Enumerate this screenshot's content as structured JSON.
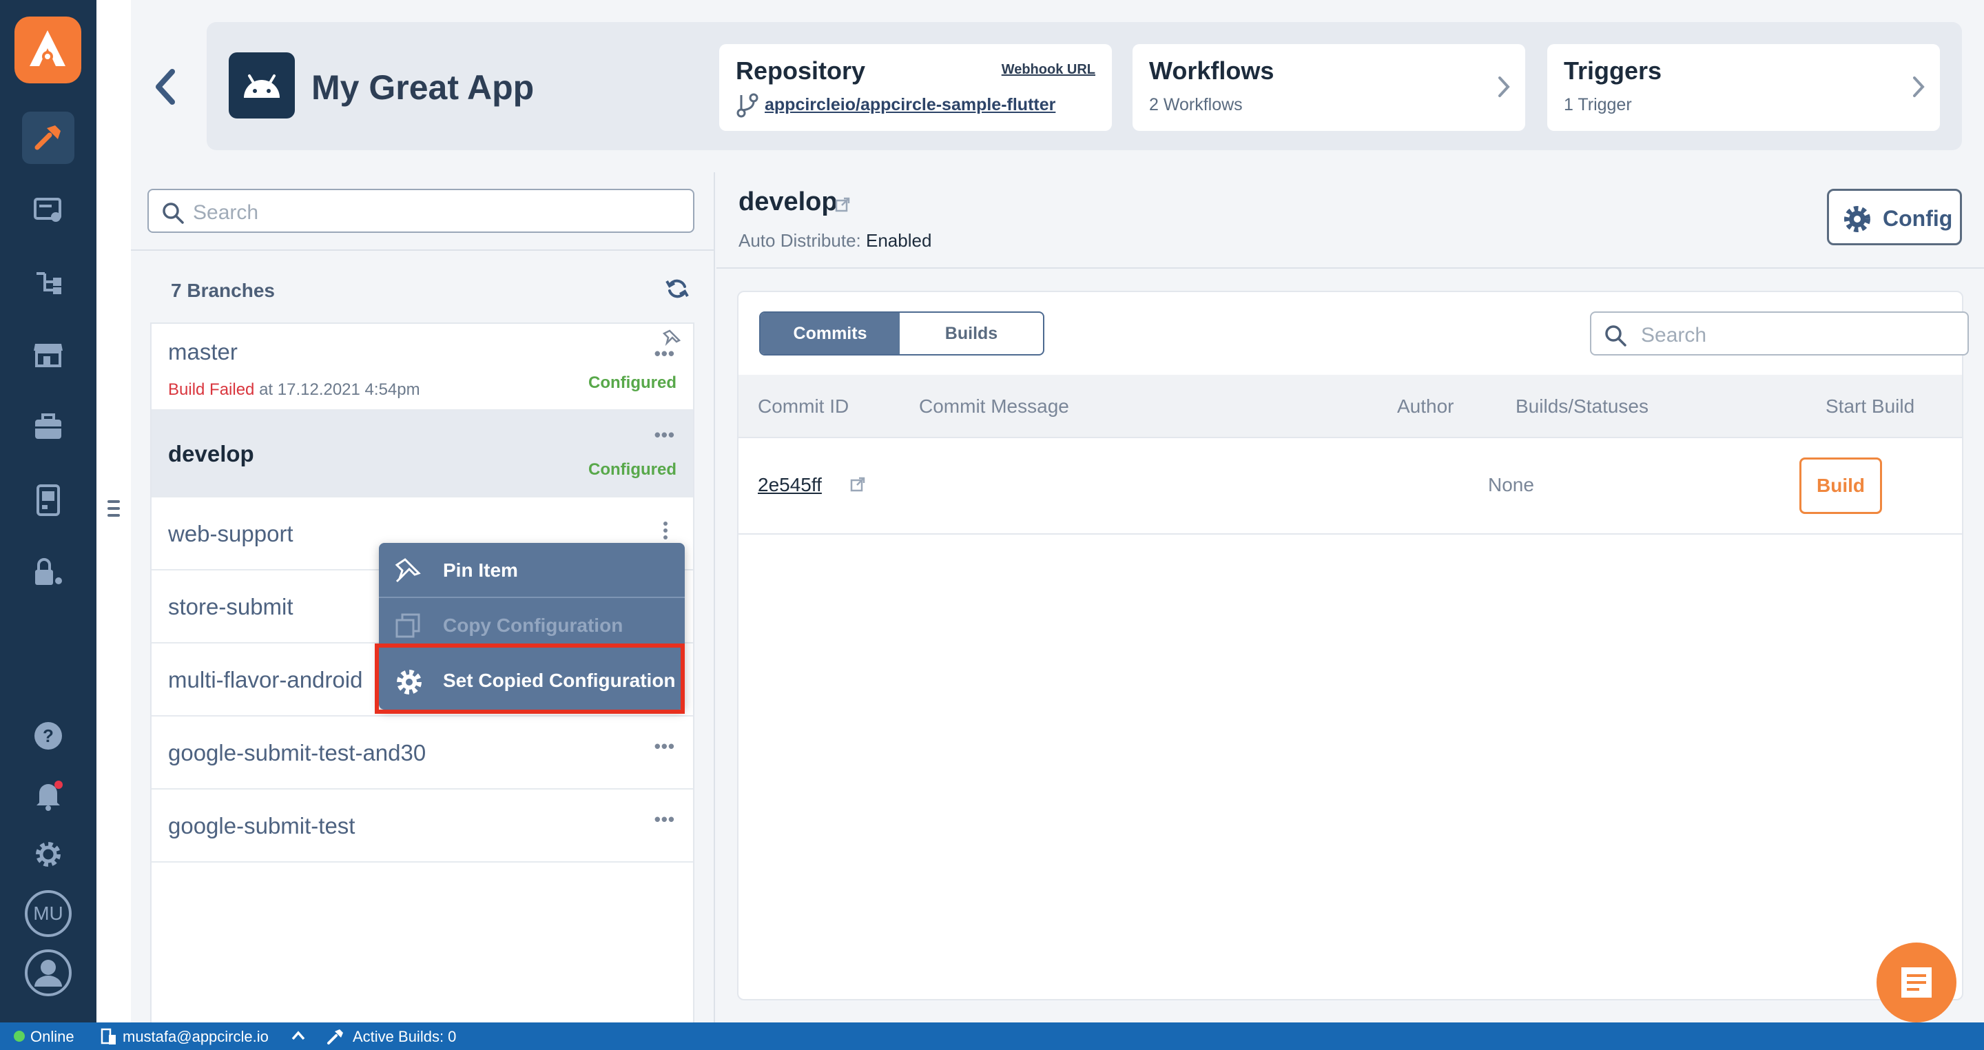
{
  "app": {
    "name": "My Great App"
  },
  "header": {
    "repository": {
      "title": "Repository",
      "webhook_label": "Webhook URL",
      "repo_link": "appcircleio/appcircle-sample-flutter"
    },
    "workflows": {
      "title": "Workflows",
      "subtitle": "2 Workflows"
    },
    "triggers": {
      "title": "Triggers",
      "subtitle": "1 Trigger"
    }
  },
  "branches": {
    "search_placeholder": "Search",
    "count_label": "7 Branches",
    "items": [
      {
        "name": "master",
        "status_prefix": "Build Failed",
        "status_suffix": "at 17.12.2021 4:54pm",
        "badge": "Configured",
        "pinned": true
      },
      {
        "name": "develop",
        "badge": "Configured",
        "selected": true
      },
      {
        "name": "web-support"
      },
      {
        "name": "store-submit"
      },
      {
        "name": "multi-flavor-android"
      },
      {
        "name": "google-submit-test-and30"
      },
      {
        "name": "google-submit-test"
      }
    ]
  },
  "context_menu": {
    "items": [
      {
        "label": "Pin Item",
        "icon": "pin-icon",
        "enabled": true
      },
      {
        "label": "Copy Configuration",
        "icon": "copy-icon",
        "enabled": false
      },
      {
        "label": "Set Copied Configuration",
        "icon": "gear-icon",
        "enabled": true,
        "highlighted": true
      }
    ]
  },
  "detail": {
    "branch_title": "develop",
    "auto_distribute_label": "Auto Distribute:",
    "auto_distribute_value": "Enabled",
    "config_label": "Config",
    "tabs": {
      "commits": "Commits",
      "builds": "Builds",
      "active": "commits"
    },
    "search_placeholder": "Search",
    "columns": [
      "Commit ID",
      "Commit Message",
      "Author",
      "Builds/Statuses",
      "Start Build"
    ],
    "rows": [
      {
        "commit_id": "2e545ff",
        "message": "",
        "author": "",
        "builds_status": "None",
        "action": "Build"
      }
    ]
  },
  "statusbar": {
    "online": "Online",
    "user": "mustafa@appcircle.io",
    "active_builds": "Active Builds: 0"
  },
  "nav": {
    "avatar_initials": "MU"
  },
  "colors": {
    "nav_bg": "#1b3550",
    "accent": "#f57a36",
    "menu_bg": "#5b7699",
    "highlight": "#e8301e",
    "success": "#58a84a",
    "error": "#d9363e",
    "statusbar": "#1868b3"
  }
}
